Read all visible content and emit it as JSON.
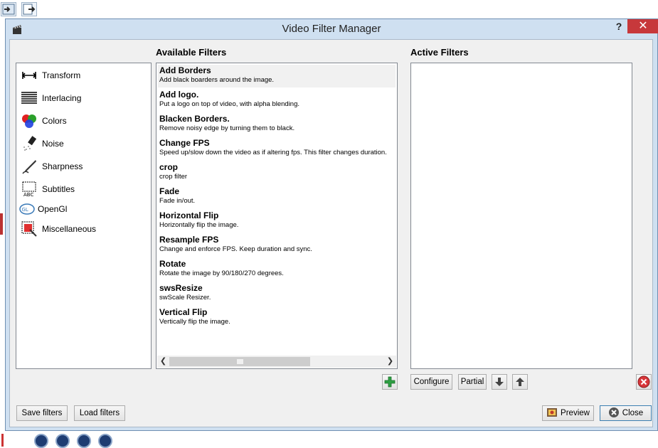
{
  "window": {
    "title": "Video Filter Manager",
    "help": "?",
    "close_glyph": "✕"
  },
  "sections": {
    "available": "Available Filters",
    "active": "Active Filters"
  },
  "categories": [
    {
      "label": "Transform",
      "icon": "transform-icon"
    },
    {
      "label": "Interlacing",
      "icon": "interlacing-icon"
    },
    {
      "label": "Colors",
      "icon": "colors-icon"
    },
    {
      "label": "Noise",
      "icon": "noise-icon"
    },
    {
      "label": "Sharpness",
      "icon": "sharpness-icon"
    },
    {
      "label": "Subtitles",
      "icon": "subtitles-icon"
    },
    {
      "label": "OpenGl",
      "icon": "opengl-icon"
    },
    {
      "label": "Miscellaneous",
      "icon": "miscellaneous-icon"
    }
  ],
  "filters": [
    {
      "name": "Add Borders",
      "desc": "Add black boarders around the image."
    },
    {
      "name": "Add logo.",
      "desc": "Put a logo on top of video, with alpha blending."
    },
    {
      "name": "Blacken Borders.",
      "desc": "Remove noisy edge by turning them to black."
    },
    {
      "name": "Change FPS",
      "desc": "Speed up/slow down the video as if altering fps. This filter changes duration."
    },
    {
      "name": "crop",
      "desc": "crop filter"
    },
    {
      "name": "Fade",
      "desc": "Fade in/out."
    },
    {
      "name": "Horizontal Flip",
      "desc": "Horizontally flip the image."
    },
    {
      "name": "Resample FPS",
      "desc": "Change and enforce FPS. Keep duration and sync."
    },
    {
      "name": "Rotate",
      "desc": "Rotate the image by 90/180/270 degrees."
    },
    {
      "name": "swsResize",
      "desc": "swScale Resizer."
    },
    {
      "name": "Vertical Flip",
      "desc": "Vertically flip the image."
    }
  ],
  "buttons": {
    "configure": "Configure",
    "partial": "Partial",
    "save_filters": "Save filters",
    "load_filters": "Load filters",
    "preview": "Preview",
    "close": "Close"
  },
  "colors": {
    "accent_red": "#c7383b",
    "add_green": "#2ea043",
    "frame": "#cfe0f1"
  }
}
